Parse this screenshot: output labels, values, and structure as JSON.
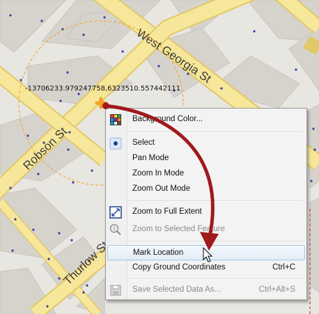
{
  "map": {
    "coordinate_readout": "-13706233.979247758,6323510.557442111",
    "streets": {
      "west_georgia": "West Georgia St",
      "robson": "Robson St",
      "thurlow": "Thurlow St"
    }
  },
  "context_menu": {
    "items": [
      {
        "label": "Background Color...",
        "icon": "color-grid-icon"
      },
      {
        "label": "Select",
        "icon": "radio-selected-icon"
      },
      {
        "label": "Pan Mode"
      },
      {
        "label": "Zoom In Mode"
      },
      {
        "label": "Zoom Out Mode"
      },
      {
        "label": "Zoom to Full Extent",
        "icon": "full-extent-icon"
      },
      {
        "label": "Zoom to Selected Feature",
        "icon": "zoom-info-icon",
        "disabled": true
      },
      {
        "label": "Mark Location",
        "highlighted": true
      },
      {
        "label": "Copy Ground Coordinates",
        "shortcut": "Ctrl+C"
      },
      {
        "label": "Save Selected Data As...",
        "shortcut": "Ctrl+Alt+S",
        "icon": "save-icon",
        "disabled": true
      }
    ]
  },
  "colors": {
    "map_background": "#e8e6e1",
    "block_fill": "#d6d3cd",
    "road_yellow": "#f6e79a",
    "road_edge": "#e1c868",
    "arrow": "#a0191c",
    "marker": "#f2a122",
    "highlight_border": "#a9c4e6"
  }
}
